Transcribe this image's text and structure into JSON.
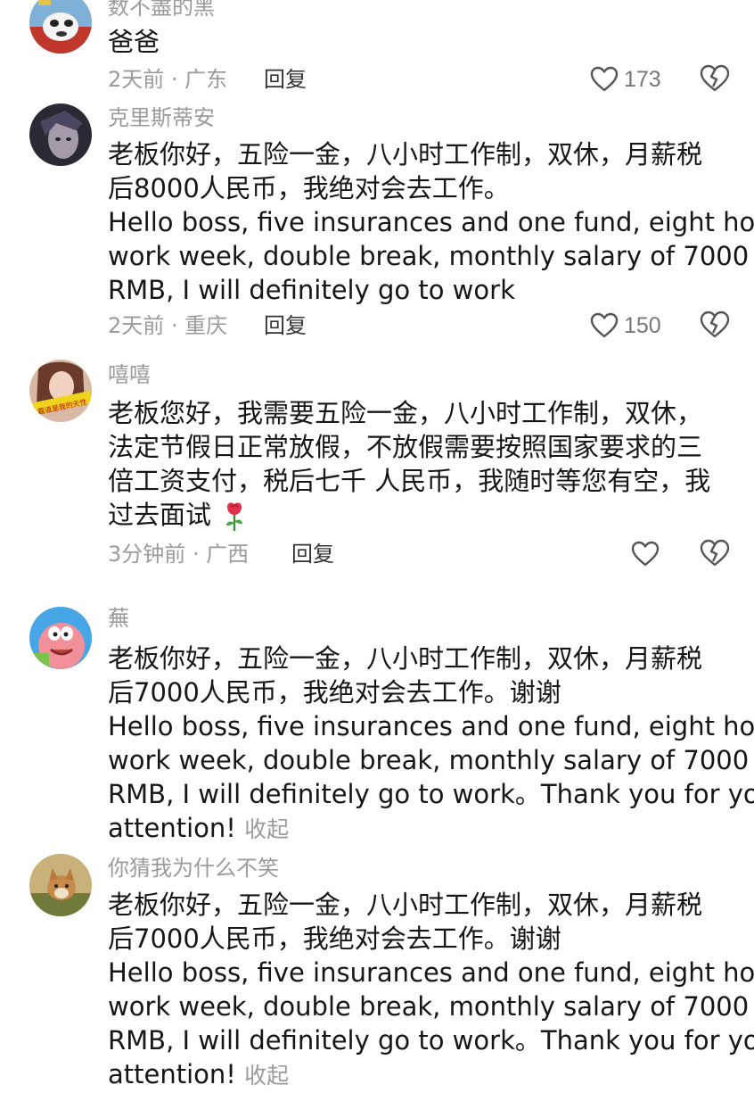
{
  "comments": [
    {
      "username": "数不盡的黑",
      "lines": [
        "爸爸"
      ],
      "meta": "2天前 · 广东",
      "reply_label": "回复",
      "likes": "173",
      "avatar": "cartoon-dog-avatar"
    },
    {
      "username": "克里斯蒂安",
      "lines": [
        "老板你好，五险一金，八小时工作制，双休，月薪税",
        "后8000人民币，我绝对会去工作。",
        "Hello boss, five insurances and one fund, eight hour",
        "work week, double break, monthly salary of 7000",
        "RMB, I will definitely go to work"
      ],
      "meta": "2天前 · 重庆",
      "reply_label": "回复",
      "likes": "150",
      "avatar": "anime-boy-avatar"
    },
    {
      "username": "嘻嘻",
      "lines": [
        "老板您好，我需要五险一金，八小时工作制，双休，",
        "法定节假日正常放假，不放假需要按照国家要求的三",
        "倍工资支付，税后七千 人民币，我随时等您有空，我",
        "过去面试"
      ],
      "meta": "3分钟前 · 广西",
      "reply_label": "回复",
      "likes": "",
      "avatar": "woman-photo-avatar",
      "avatar_text": "霸道是我的天性",
      "emoji": "rose-emoji"
    },
    {
      "username": "蕪",
      "lines": [
        "老板你好，五险一金，八小时工作制，双休，月薪税",
        "后7000人民币，我绝对会去工作。谢谢",
        "Hello boss, five insurances and one fund, eight hour",
        "work week, double break, monthly salary of 7000",
        "RMB, I will definitely go to work。Thank you for your",
        "attention!"
      ],
      "collapse_label": "收起",
      "avatar": "patrick-star-avatar"
    },
    {
      "username": "你猜我为什么不笑",
      "lines": [
        "老板你好，五险一金，八小时工作制，双休，月薪税",
        "后7000人民币，我绝对会去工作。谢谢",
        "Hello boss, five insurances and one fund, eight hour",
        "work week, double break, monthly salary of 7000",
        "RMB, I will definitely go to work。Thank you for your",
        "attention!"
      ],
      "collapse_label": "收起",
      "avatar": "fox-photo-avatar"
    }
  ],
  "icons": {
    "like": "heart-outline-icon",
    "dislike": "broken-heart-icon"
  },
  "colors": {
    "username": "#9b9b9b",
    "meta": "#9b9b9b",
    "text": "#161616",
    "icon": "#555555"
  }
}
